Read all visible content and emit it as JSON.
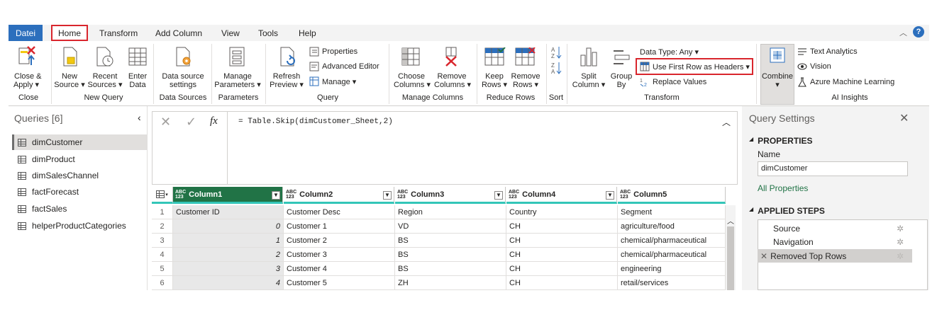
{
  "ribbon_tabs": [
    "Datei",
    "Home",
    "Transform",
    "Add Column",
    "View",
    "Tools",
    "Help"
  ],
  "groups": {
    "close": {
      "button": "Close &\nApply",
      "button_l1": "Close &",
      "button_l2": "Apply ▾",
      "label": "Close"
    },
    "new_query": {
      "new_l1": "New",
      "new_l2": "Source ▾",
      "recent_l1": "Recent",
      "recent_l2": "Sources ▾",
      "enter_l1": "Enter",
      "enter_l2": "Data",
      "label": "New Query"
    },
    "data_sources": {
      "l1": "Data source",
      "l2": "settings",
      "label": "Data Sources"
    },
    "parameters": {
      "l1": "Manage",
      "l2": "Parameters ▾",
      "label": "Parameters"
    },
    "query": {
      "refresh_l1": "Refresh",
      "refresh_l2": "Preview ▾",
      "properties": "Properties",
      "advanced_editor": "Advanced Editor",
      "manage": "Manage ▾",
      "label": "Query"
    },
    "manage_columns": {
      "choose_l1": "Choose",
      "choose_l2": "Columns ▾",
      "remove_l1": "Remove",
      "remove_l2": "Columns ▾",
      "label": "Manage Columns"
    },
    "reduce_rows": {
      "keep_l1": "Keep",
      "keep_l2": "Rows ▾",
      "remove_l1": "Remove",
      "remove_l2": "Rows ▾",
      "label": "Reduce Rows"
    },
    "sort": {
      "label": "Sort"
    },
    "transform": {
      "split_l1": "Split",
      "split_l2": "Column ▾",
      "group_l1": "Group",
      "group_l2": "By",
      "data_type": "Data Type: Any ▾",
      "first_row": "Use First Row as Headers ▾",
      "replace": "Replace Values",
      "label": "Transform"
    },
    "combine": {
      "l1": "Combine",
      "l2": "▾"
    },
    "ai": {
      "text_analytics": "Text Analytics",
      "vision": "Vision",
      "azure_ml": "Azure Machine Learning",
      "label": "AI Insights"
    }
  },
  "queries": {
    "title": "Queries [6]",
    "items": [
      "dimCustomer",
      "dimProduct",
      "dimSalesChannel",
      "factForecast",
      "factSales",
      "helperProductCategories"
    ],
    "selected": "dimCustomer"
  },
  "formula": {
    "fx": "fx",
    "text": "= Table.Skip(dimCustomer_Sheet,2)"
  },
  "grid": {
    "type_badge_top": "ABC",
    "type_badge_bottom": "123",
    "columns": [
      "Column1",
      "Column2",
      "Column3",
      "Column4",
      "Column5"
    ],
    "rows": [
      {
        "n": "1",
        "c1": "Customer ID",
        "c2": "Customer Desc",
        "c3": "Region",
        "c4": "Country",
        "c5": "Segment"
      },
      {
        "n": "2",
        "c1": "0",
        "c2": "Customer 1",
        "c3": "VD",
        "c4": "CH",
        "c5": "agriculture/food"
      },
      {
        "n": "3",
        "c1": "1",
        "c2": "Customer 2",
        "c3": "BS",
        "c4": "CH",
        "c5": "chemical/pharmaceutical"
      },
      {
        "n": "4",
        "c1": "2",
        "c2": "Customer 3",
        "c3": "BS",
        "c4": "CH",
        "c5": "chemical/pharmaceutical"
      },
      {
        "n": "5",
        "c1": "3",
        "c2": "Customer 4",
        "c3": "BS",
        "c4": "CH",
        "c5": "engineering"
      },
      {
        "n": "6",
        "c1": "4",
        "c2": "Customer 5",
        "c3": "ZH",
        "c4": "CH",
        "c5": "retail/services"
      }
    ]
  },
  "settings": {
    "title": "Query Settings",
    "properties_header": "PROPERTIES",
    "name_label": "Name",
    "name_value": "dimCustomer",
    "all_properties": "All Properties",
    "steps_header": "APPLIED STEPS",
    "steps": [
      "Source",
      "Navigation",
      "Removed Top Rows"
    ]
  },
  "colors": {
    "accent": "#2c6fbd",
    "highlight": "#d9262d",
    "teal": "#33c6b8",
    "selected_header": "#217346"
  }
}
